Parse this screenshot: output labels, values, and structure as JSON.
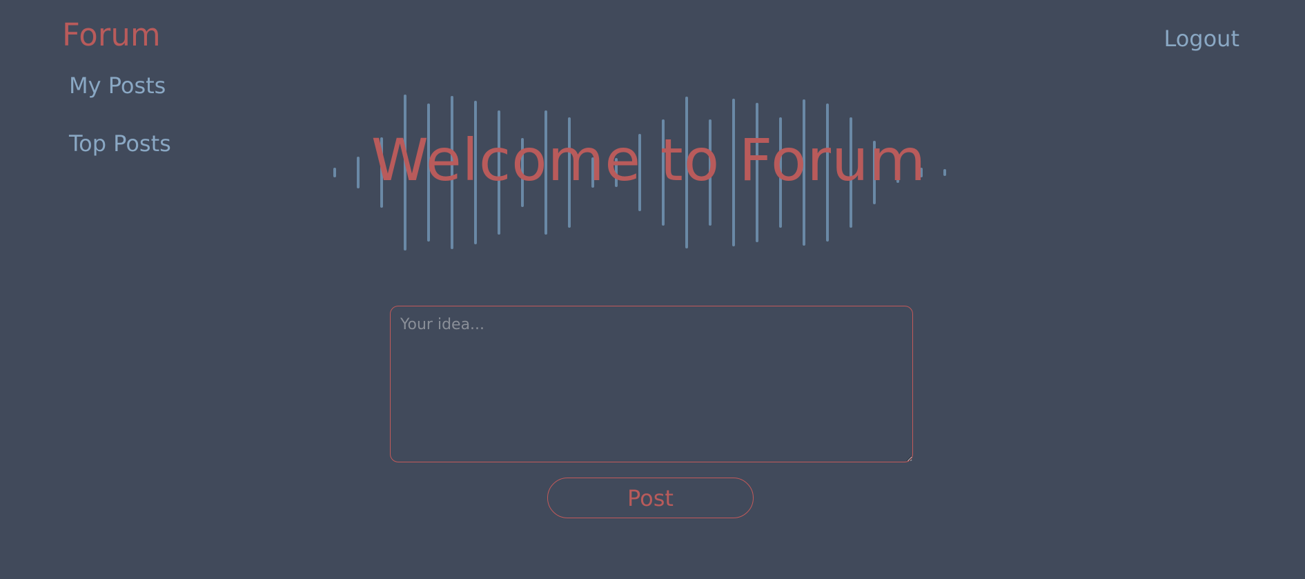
{
  "header": {
    "brand": "Forum",
    "logout_label": "Logout"
  },
  "sidebar": {
    "items": [
      {
        "label": "My Posts"
      },
      {
        "label": "Top Posts"
      }
    ]
  },
  "hero": {
    "title": "Welcome to Forum",
    "wave_color": "#6a89a6"
  },
  "compose": {
    "placeholder": "Your idea...",
    "value": "",
    "post_label": "Post"
  },
  "colors": {
    "background": "#414a5b",
    "accent": "#b95b5b",
    "link": "#8aa8c4"
  }
}
